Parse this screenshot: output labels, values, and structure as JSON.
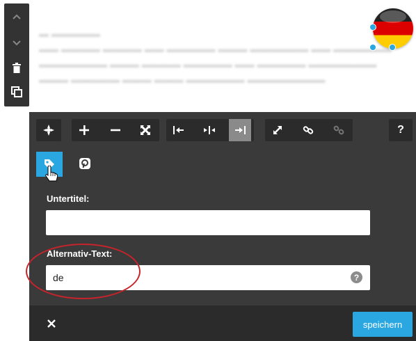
{
  "side_toolbar": {
    "icons": [
      "chevron-up-icon",
      "chevron-down-icon",
      "trash-icon",
      "copy-icon"
    ]
  },
  "image_toolbar": {
    "icons": [
      "image-settings-icon",
      "zoom-in-icon",
      "zoom-out-icon",
      "fullscreen-icon",
      "align-left-icon",
      "align-center-icon",
      "align-right-icon",
      "resize-icon",
      "link-icon",
      "unlink-icon",
      "help-icon"
    ],
    "help_label": "?",
    "active": "align-right-icon",
    "disabled": "unlink-icon"
  },
  "tabs": {
    "active": "tag-icon",
    "items": [
      "tag-icon",
      "pinterest-icon"
    ]
  },
  "form": {
    "subtitle_label": "Untertitel:",
    "subtitle_value": "",
    "alt_label": "Alternativ-Text:",
    "alt_value": "de",
    "alt_help": "?"
  },
  "footer": {
    "close_label": "✕",
    "save_label": "speichern"
  },
  "colors": {
    "accent": "#2aa7e0",
    "panel": "#3a3a3a",
    "toolbar": "#2b2b2b",
    "annotation": "#c8232b"
  }
}
